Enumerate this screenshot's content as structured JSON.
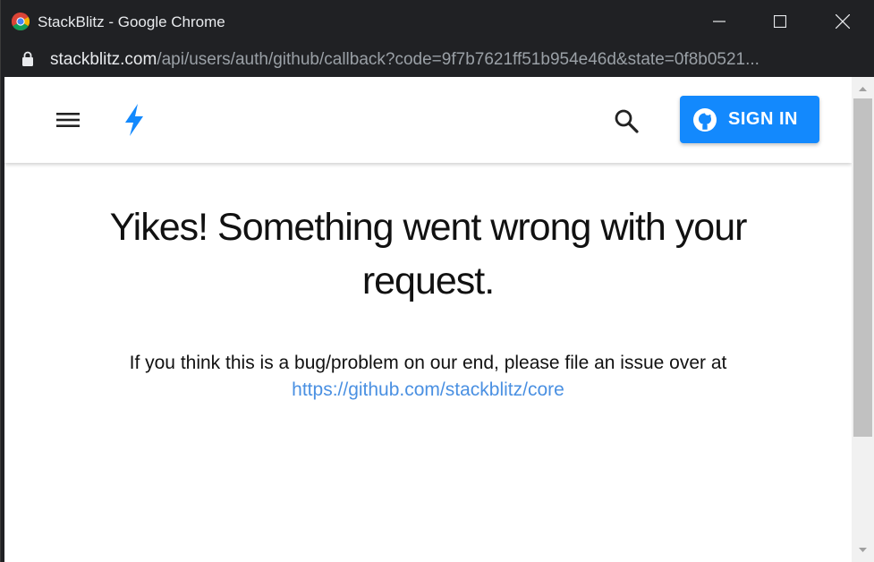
{
  "window": {
    "title": "StackBlitz - Google Chrome"
  },
  "address_bar": {
    "host": "stackblitz.com",
    "path": "/api/users/auth/github/callback?code=9f7b7621ff51b954e46d&state=0f8b0521..."
  },
  "app_bar": {
    "sign_in_label": "SIGN IN",
    "menu_icon": "hamburger-menu-icon",
    "logo_icon": "lightning-bolt-icon",
    "search_icon": "search-icon",
    "accent_color": "#1389fd"
  },
  "error": {
    "headline": "Yikes! Something went wrong with your request.",
    "message": "If you think this is a bug/problem on our end, please file an issue over at",
    "link_text": "https://github.com/stackblitz/core",
    "link_color": "#4a90e2"
  }
}
